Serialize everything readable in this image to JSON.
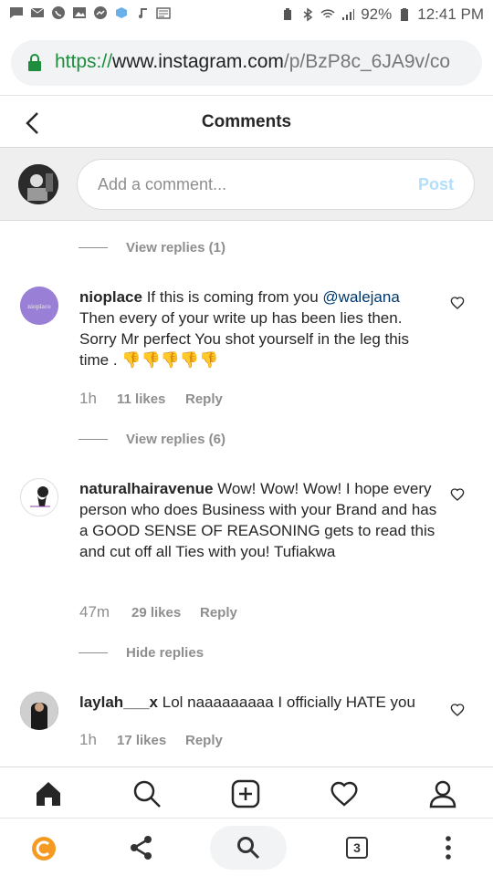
{
  "status_bar": {
    "battery": "92%",
    "time": "12:41 PM"
  },
  "url_bar": {
    "scheme": "https://",
    "domain": "www.instagram.com",
    "path": "/p/BzP8c_6JA9v/co"
  },
  "header": {
    "title": "Comments"
  },
  "composer": {
    "placeholder": "Add a comment...",
    "post_label": "Post"
  },
  "threads": {
    "view_replies_1": "View replies (1)",
    "view_replies_2": "View replies (6)",
    "hide_replies": "Hide replies"
  },
  "comments": [
    {
      "username": "nioplace",
      "text_before": " If this is coming from you ",
      "mention": "@walejana",
      "text_after": " Then every of your write up has been lies then. Sorry Mr perfect You shot yourself in the leg this time . ",
      "emoji": "👎👎👎👎👎",
      "time": "1h",
      "likes": "11 likes",
      "reply": "Reply"
    },
    {
      "username": "naturalhairavenue",
      "text": " Wow! Wow! Wow! I hope every person who does Business with your Brand and has a GOOD SENSE OF REASONING gets to read this and cut off all Ties with you! Tufiakwa",
      "time": "47m",
      "likes": "29 likes",
      "reply": "Reply"
    },
    {
      "username": "laylah___x",
      "text": " Lol naaaaaaaaa I officially HATE you",
      "time": "1h",
      "likes": "17 likes",
      "reply": "Reply"
    }
  ],
  "browser_bar": {
    "tab_count": "3"
  },
  "colors": {
    "link": "#00376b",
    "post_disabled": "#b2dffc",
    "secure_green": "#1e8e3e",
    "muted": "#8e8e8e"
  }
}
